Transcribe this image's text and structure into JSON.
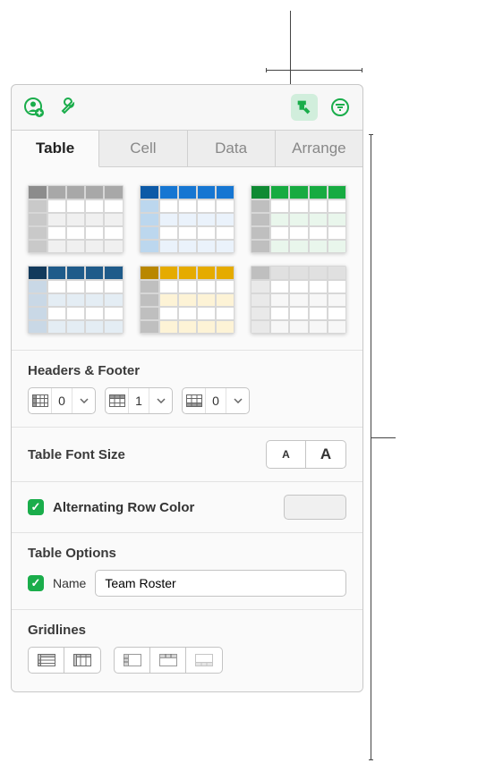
{
  "tabs": {
    "table": "Table",
    "cell": "Cell",
    "data": "Data",
    "arrange": "Arrange",
    "active": "table"
  },
  "headersFooter": {
    "title": "Headers & Footer",
    "headerCols": "0",
    "headerRows": "1",
    "footerRows": "0"
  },
  "fontSize": {
    "title": "Table Font Size",
    "small": "A",
    "big": "A"
  },
  "altRow": {
    "label": "Alternating Row Color",
    "checked": true
  },
  "tableOptions": {
    "title": "Table Options",
    "nameLabel": "Name",
    "nameChecked": true,
    "nameValue": "Team Roster"
  },
  "gridlines": {
    "title": "Gridlines"
  },
  "styleThumbs": [
    {
      "corner": "#8c8c8c",
      "head": "#a8a8a8",
      "side": "#c9c9c9",
      "body": "#fff",
      "bodyalt": "#f0f0f0"
    },
    {
      "corner": "#0d5aa7",
      "head": "#1676d2",
      "side": "#bcd7ee",
      "body": "#fff",
      "bodyalt": "#eaf2fb"
    },
    {
      "corner": "#0f8a33",
      "head": "#17ab41",
      "side": "#bfbfbf",
      "body": "#fff",
      "bodyalt": "#e9f6ec"
    },
    {
      "corner": "#123a5c",
      "head": "#1f5b8a",
      "side": "#c9d8e6",
      "body": "#fff",
      "bodyalt": "#e4edf4"
    },
    {
      "corner": "#b98700",
      "head": "#e5ab00",
      "side": "#bfbfbf",
      "body": "#fff",
      "bodyalt": "#fdf3d6"
    },
    {
      "corner": "#bfbfbf",
      "head": "#e0e0e0",
      "side": "#e9e9e9",
      "body": "#fff",
      "bodyalt": "#f7f7f7"
    }
  ]
}
